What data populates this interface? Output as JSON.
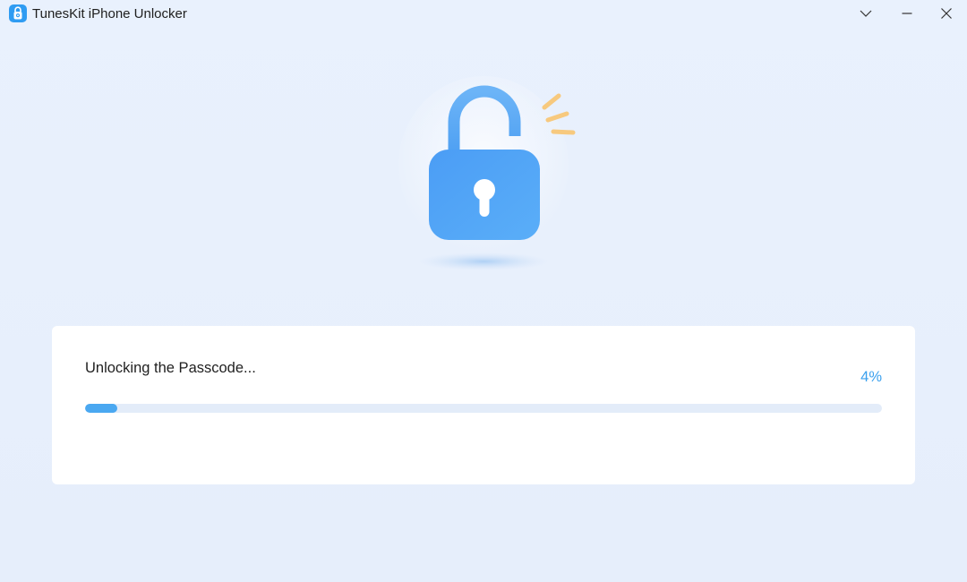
{
  "window": {
    "title": "TunesKit iPhone Unlocker",
    "controls": [
      "collapse",
      "minimize",
      "close"
    ]
  },
  "hero": {
    "icon": "unlocked-padlock-icon"
  },
  "progress": {
    "status": "Unlocking the Passcode...",
    "percent_label": "4%",
    "fraction": 0.04
  },
  "colors": {
    "background": "#e7effc",
    "accent": "#3aa0ee",
    "progress_fill": "#4aa8f1",
    "progress_track": "#e3ecf9",
    "sparks": "#f7c97e"
  }
}
